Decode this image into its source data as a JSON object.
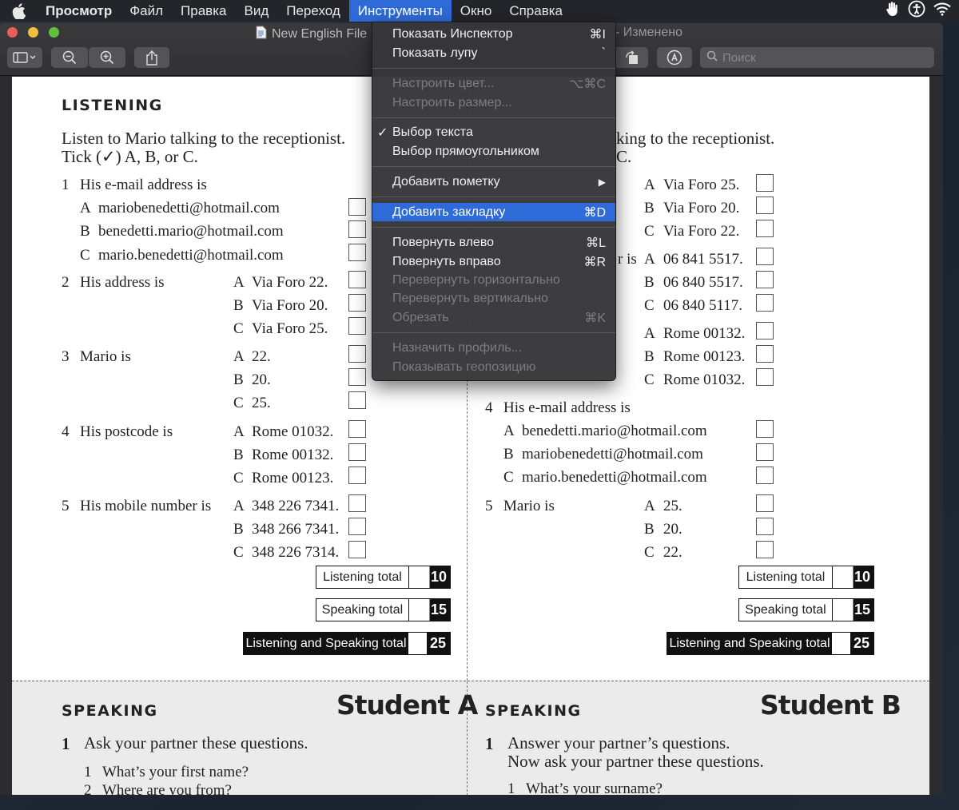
{
  "menubar": {
    "app": "Просмотр",
    "items": [
      "Файл",
      "Правка",
      "Вид",
      "Переход",
      "Инструменты",
      "Окно",
      "Справка"
    ],
    "active": "Инструменты"
  },
  "window": {
    "title": "New English File",
    "status": "- Изменено",
    "search_placeholder": "Поиск"
  },
  "menu": {
    "show_inspector": "Показать Инспектор",
    "show_inspector_sc": "⌘I",
    "show_magnifier": "Показать лупу",
    "show_magnifier_sc": "`",
    "adjust_color": "Настроить цвет...",
    "adjust_color_sc": "⌥⌘C",
    "adjust_size": "Настроить размер...",
    "text_selection": "Выбор текста",
    "rect_selection": "Выбор прямоугольником",
    "annotate": "Добавить пометку",
    "annotate_arrow": "▶",
    "add_bookmark": "Добавить закладку",
    "add_bookmark_sc": "⌘D",
    "rotate_left": "Повернуть влево",
    "rotate_left_sc": "⌘L",
    "rotate_right": "Повернуть вправо",
    "rotate_right_sc": "⌘R",
    "flip_h": "Перевернуть горизонтально",
    "flip_v": "Перевернуть вертикально",
    "crop": "Обрезать",
    "crop_sc": "⌘K",
    "assign_profile": "Назначить профиль...",
    "show_location": "Показывать геопозицию",
    "checkmark": "✓"
  },
  "left": {
    "heading": "LISTENING",
    "instruction1": "Listen to Mario talking to the receptionist.",
    "instruction2": "Tick (✓) A, B, or C.",
    "q1": {
      "n": "1",
      "text": "His e-mail address is",
      "a": "mariobenedetti@hotmail.com",
      "b": "benedetti.mario@hotmail.com",
      "c": "mario.benedetti@hotmail.com"
    },
    "q2": {
      "n": "2",
      "text": "His address is",
      "a": "Via Foro 22.",
      "b": "Via Foro 20.",
      "c": "Via Foro 25."
    },
    "q3": {
      "n": "3",
      "text": "Mario is",
      "a": "22.",
      "b": "20.",
      "c": "25."
    },
    "q4": {
      "n": "4",
      "text": "His postcode is",
      "a": "Rome 01032.",
      "b": "Rome 00132.",
      "c": "Rome 00123."
    },
    "q5": {
      "n": "5",
      "text": "His mobile number is",
      "a": "348 226 7341.",
      "b": "348 266 7341.",
      "c": "348 226 7314."
    }
  },
  "right": {
    "instruction1": "king to the receptionist.",
    "instruction2": "C.",
    "q2": {
      "a": "Via Foro 25.",
      "b": "Via Foro 20.",
      "c": "Via Foro 22."
    },
    "q3": {
      "frag": "r is",
      "a": "06 841 5517.",
      "b": "06 840 5517.",
      "c": "06 840 5117."
    },
    "qx": {
      "a": "Rome 00132.",
      "b": "Rome 00123.",
      "c": "Rome 01032."
    },
    "q4": {
      "n": "4",
      "text": "His e-mail address is",
      "a": "benedetti.mario@hotmail.com",
      "b": "mariobenedetti@hotmail.com",
      "c": "mario.benedetti@hotmail.com"
    },
    "q5": {
      "n": "5",
      "text": "Mario is",
      "a": "25.",
      "b": "20.",
      "c": "22."
    }
  },
  "letters": {
    "a": "A",
    "b": "B",
    "c": "C"
  },
  "totals": {
    "listening": "Listening total",
    "listening_val": "10",
    "speaking": "Speaking total",
    "speaking_val": "15",
    "both": "Listening and Speaking total",
    "both_val": "25"
  },
  "speaking_left": {
    "heading": "SPEAKING",
    "student": "Student A",
    "n": "1",
    "instruction": "Ask your partner these questions.",
    "q1": "What’s your first name?",
    "q2": "Where are you from?"
  },
  "speaking_right": {
    "heading": "SPEAKING",
    "student": "Student B",
    "n": "1",
    "instruction1": "Answer your partner’s questions.",
    "instruction2": "Now ask your partner these questions.",
    "q1": "What’s your surname?"
  }
}
